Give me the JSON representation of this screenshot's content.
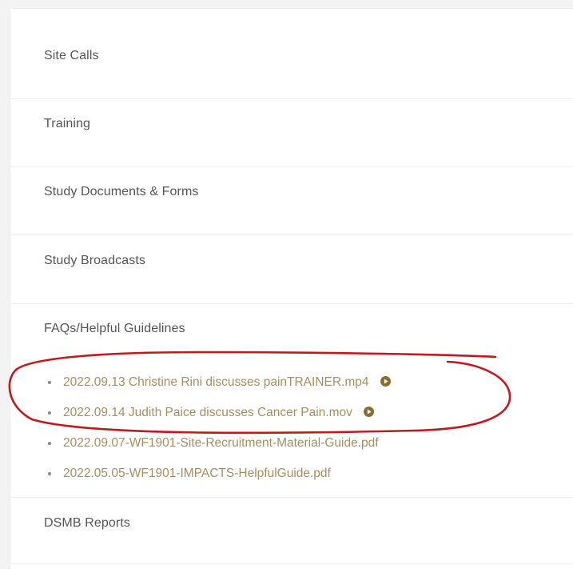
{
  "sections": {
    "site_calls": "Site Calls",
    "training": "Training",
    "study_documents": "Study Documents & Forms",
    "study_broadcasts": "Study Broadcasts",
    "faqs": "FAQs/Helpful Guidelines",
    "dsmb_reports": "DSMB Reports"
  },
  "faq_files": [
    {
      "name": "2022.09.13 Christine Rini discusses painTRAINER.mp4",
      "icon": "play-circle-icon"
    },
    {
      "name": "2022.09.14 Judith Paice discusses Cancer Pain.mov",
      "icon": "play-circle-icon"
    },
    {
      "name": "2022.09.07-WF1901-Site-Recruitment-Material-Guide.pdf"
    },
    {
      "name": "2022.05.05-WF1901-IMPACTS-HelpfulGuide.pdf"
    }
  ],
  "colors": {
    "link": "#a88e5d",
    "play_icon": "#8a6d2e",
    "annotation": "#c8161d",
    "section_text": "#555555"
  }
}
